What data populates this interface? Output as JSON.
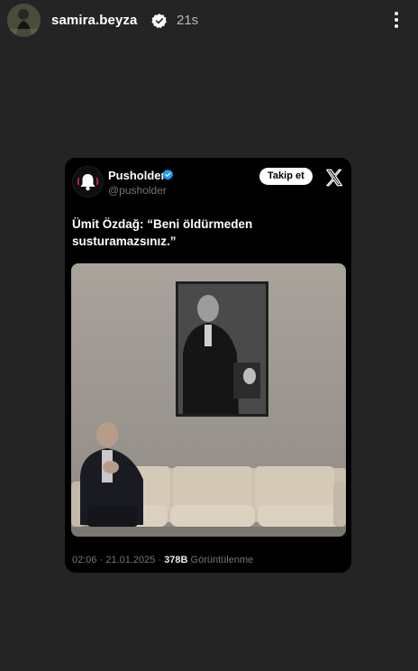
{
  "story": {
    "username": "samira.beyza",
    "time": "21s",
    "icons": {
      "avatar": "profile-avatar",
      "verified": "verified-icon",
      "more": "more-vertical-icon"
    }
  },
  "tweet": {
    "account_name": "Pusholder",
    "handle": "@pusholder",
    "follow_label": "Takip et",
    "text_line1": "Ümit Özdağ: “Beni öldürmeden",
    "text_line2": "susturamazsınız.”",
    "time": "02:06",
    "date": "21.01.2025",
    "views": "378B",
    "views_label": "Görüntülenme",
    "icons": {
      "avatar": "bell-icon",
      "verified": "verified-icon",
      "brand": "x-logo-icon"
    },
    "colors": {
      "card_bg": "#000000",
      "verified": "#1d9bf0",
      "muted": "#71767b"
    }
  }
}
